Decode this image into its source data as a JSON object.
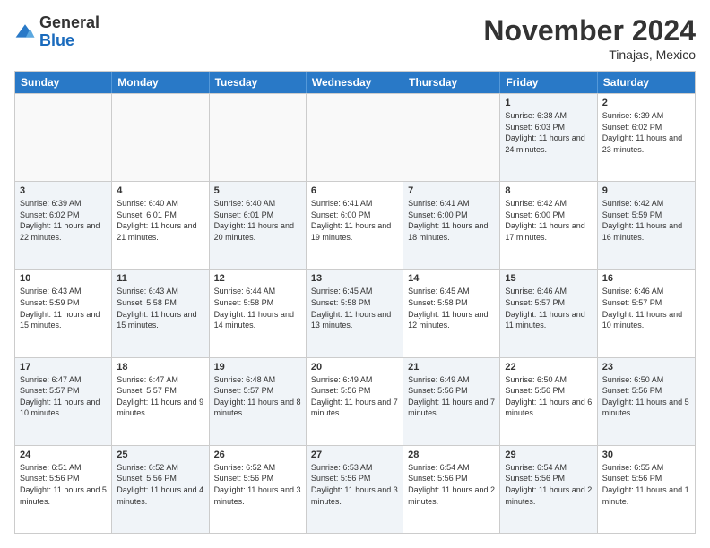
{
  "logo": {
    "general": "General",
    "blue": "Blue"
  },
  "header": {
    "month": "November 2024",
    "location": "Tinajas, Mexico"
  },
  "weekdays": [
    "Sunday",
    "Monday",
    "Tuesday",
    "Wednesday",
    "Thursday",
    "Friday",
    "Saturday"
  ],
  "rows": [
    [
      {
        "day": "",
        "info": "",
        "empty": true
      },
      {
        "day": "",
        "info": "",
        "empty": true
      },
      {
        "day": "",
        "info": "",
        "empty": true
      },
      {
        "day": "",
        "info": "",
        "empty": true
      },
      {
        "day": "",
        "info": "",
        "empty": true
      },
      {
        "day": "1",
        "info": "Sunrise: 6:38 AM\nSunset: 6:03 PM\nDaylight: 11 hours and 24 minutes.",
        "shaded": true
      },
      {
        "day": "2",
        "info": "Sunrise: 6:39 AM\nSunset: 6:02 PM\nDaylight: 11 hours and 23 minutes.",
        "shaded": false
      }
    ],
    [
      {
        "day": "3",
        "info": "Sunrise: 6:39 AM\nSunset: 6:02 PM\nDaylight: 11 hours and 22 minutes.",
        "shaded": true
      },
      {
        "day": "4",
        "info": "Sunrise: 6:40 AM\nSunset: 6:01 PM\nDaylight: 11 hours and 21 minutes.",
        "shaded": false
      },
      {
        "day": "5",
        "info": "Sunrise: 6:40 AM\nSunset: 6:01 PM\nDaylight: 11 hours and 20 minutes.",
        "shaded": true
      },
      {
        "day": "6",
        "info": "Sunrise: 6:41 AM\nSunset: 6:00 PM\nDaylight: 11 hours and 19 minutes.",
        "shaded": false
      },
      {
        "day": "7",
        "info": "Sunrise: 6:41 AM\nSunset: 6:00 PM\nDaylight: 11 hours and 18 minutes.",
        "shaded": true
      },
      {
        "day": "8",
        "info": "Sunrise: 6:42 AM\nSunset: 6:00 PM\nDaylight: 11 hours and 17 minutes.",
        "shaded": false
      },
      {
        "day": "9",
        "info": "Sunrise: 6:42 AM\nSunset: 5:59 PM\nDaylight: 11 hours and 16 minutes.",
        "shaded": true
      }
    ],
    [
      {
        "day": "10",
        "info": "Sunrise: 6:43 AM\nSunset: 5:59 PM\nDaylight: 11 hours and 15 minutes.",
        "shaded": false
      },
      {
        "day": "11",
        "info": "Sunrise: 6:43 AM\nSunset: 5:58 PM\nDaylight: 11 hours and 15 minutes.",
        "shaded": true
      },
      {
        "day": "12",
        "info": "Sunrise: 6:44 AM\nSunset: 5:58 PM\nDaylight: 11 hours and 14 minutes.",
        "shaded": false
      },
      {
        "day": "13",
        "info": "Sunrise: 6:45 AM\nSunset: 5:58 PM\nDaylight: 11 hours and 13 minutes.",
        "shaded": true
      },
      {
        "day": "14",
        "info": "Sunrise: 6:45 AM\nSunset: 5:58 PM\nDaylight: 11 hours and 12 minutes.",
        "shaded": false
      },
      {
        "day": "15",
        "info": "Sunrise: 6:46 AM\nSunset: 5:57 PM\nDaylight: 11 hours and 11 minutes.",
        "shaded": true
      },
      {
        "day": "16",
        "info": "Sunrise: 6:46 AM\nSunset: 5:57 PM\nDaylight: 11 hours and 10 minutes.",
        "shaded": false
      }
    ],
    [
      {
        "day": "17",
        "info": "Sunrise: 6:47 AM\nSunset: 5:57 PM\nDaylight: 11 hours and 10 minutes.",
        "shaded": true
      },
      {
        "day": "18",
        "info": "Sunrise: 6:47 AM\nSunset: 5:57 PM\nDaylight: 11 hours and 9 minutes.",
        "shaded": false
      },
      {
        "day": "19",
        "info": "Sunrise: 6:48 AM\nSunset: 5:57 PM\nDaylight: 11 hours and 8 minutes.",
        "shaded": true
      },
      {
        "day": "20",
        "info": "Sunrise: 6:49 AM\nSunset: 5:56 PM\nDaylight: 11 hours and 7 minutes.",
        "shaded": false
      },
      {
        "day": "21",
        "info": "Sunrise: 6:49 AM\nSunset: 5:56 PM\nDaylight: 11 hours and 7 minutes.",
        "shaded": true
      },
      {
        "day": "22",
        "info": "Sunrise: 6:50 AM\nSunset: 5:56 PM\nDaylight: 11 hours and 6 minutes.",
        "shaded": false
      },
      {
        "day": "23",
        "info": "Sunrise: 6:50 AM\nSunset: 5:56 PM\nDaylight: 11 hours and 5 minutes.",
        "shaded": true
      }
    ],
    [
      {
        "day": "24",
        "info": "Sunrise: 6:51 AM\nSunset: 5:56 PM\nDaylight: 11 hours and 5 minutes.",
        "shaded": false
      },
      {
        "day": "25",
        "info": "Sunrise: 6:52 AM\nSunset: 5:56 PM\nDaylight: 11 hours and 4 minutes.",
        "shaded": true
      },
      {
        "day": "26",
        "info": "Sunrise: 6:52 AM\nSunset: 5:56 PM\nDaylight: 11 hours and 3 minutes.",
        "shaded": false
      },
      {
        "day": "27",
        "info": "Sunrise: 6:53 AM\nSunset: 5:56 PM\nDaylight: 11 hours and 3 minutes.",
        "shaded": true
      },
      {
        "day": "28",
        "info": "Sunrise: 6:54 AM\nSunset: 5:56 PM\nDaylight: 11 hours and 2 minutes.",
        "shaded": false
      },
      {
        "day": "29",
        "info": "Sunrise: 6:54 AM\nSunset: 5:56 PM\nDaylight: 11 hours and 2 minutes.",
        "shaded": true
      },
      {
        "day": "30",
        "info": "Sunrise: 6:55 AM\nSunset: 5:56 PM\nDaylight: 11 hours and 1 minute.",
        "shaded": false
      }
    ]
  ]
}
